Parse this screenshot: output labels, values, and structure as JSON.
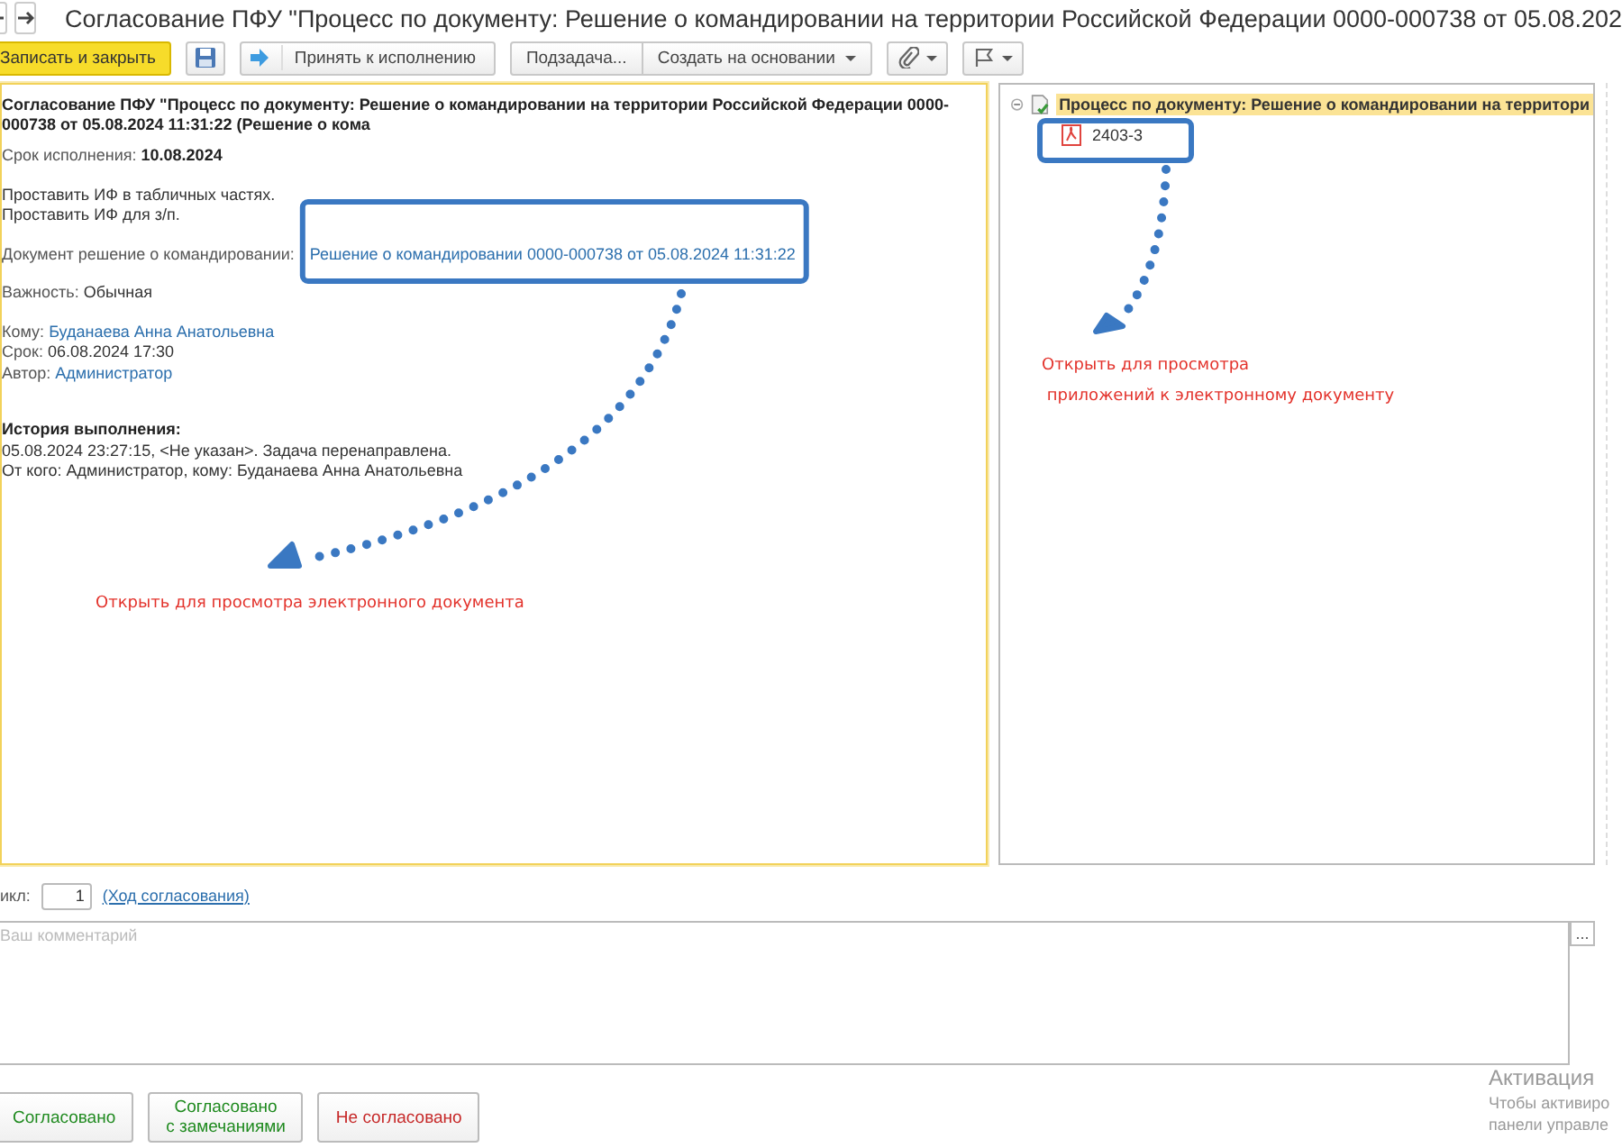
{
  "window": {
    "title": "Согласование ПФУ \"Процесс по документу: Решение о командировании на территории Российской Федерации 0000-000738 от 05.08.202"
  },
  "toolbar": [
    {
      "kind": "primary",
      "label": "Записать и закрыть"
    },
    {
      "kind": "save"
    },
    {
      "kind": "accept",
      "label": "Принять к исполнению"
    },
    {
      "kind": "group-start",
      "label": "Подзадача..."
    },
    {
      "kind": "group-dropdown",
      "label": "Создать на основании"
    },
    {
      "kind": "attach-menu"
    },
    {
      "kind": "flag-menu"
    }
  ],
  "task": {
    "title": "Согласование ПФУ \"Процесс по документу: Решение о командировании на территории Российской Федерации 0000-000738 от 05.08.2024 11:31:22 (Решение о кома",
    "due_label": "Срок исполнения:",
    "due_value": "10.08.2024",
    "description": [
      "Проставить ИФ в табличных частях.",
      "Проставить ИФ для з/п."
    ],
    "document_label": "Документ решение о командировании:",
    "document_link": "Решение о командировании 0000-000738 от 05.08.2024 11:31:22",
    "importance_label": "Важность:",
    "importance_value": "Обычная",
    "to_label": "Кому:",
    "to_value": "Буданаева Анна Анатольевна",
    "term_label": "Срок:",
    "term_value": "06.08.2024 17:30",
    "author_label": "Автор:",
    "author_value": "Администратор",
    "history_title": "История выполнения:",
    "history": [
      "05.08.2024 23:27:15, <Не указан>. Задача перенаправлена.",
      "От кого: Администратор, кому: Буданаева Анна Анатольевна"
    ]
  },
  "tree": [
    {
      "label": "Процесс по документу: Решение о командировании на территори",
      "expanded": true,
      "selected": true,
      "children": [
        {
          "label": "2403-3",
          "selected": false
        }
      ]
    }
  ],
  "cycle": {
    "label": "икл:",
    "value": "1",
    "link": "(Ход согласования)"
  },
  "comment": {
    "placeholder": "Ваш комментарий",
    "button": "..."
  },
  "actions": [
    {
      "kind": "approve",
      "label": "Согласовано"
    },
    {
      "kind": "approve",
      "label": "Согласовано\nс замечаниями"
    },
    {
      "kind": "reject",
      "label": "Не согласовано"
    }
  ],
  "annotations": [
    {
      "lines": [
        "Открыть для просмотра электронного документа"
      ]
    },
    {
      "lines": [
        "Открыть для просмотра",
        " приложений к электронному документу"
      ]
    }
  ],
  "activation_notice": {
    "title": "Активация",
    "lines": [
      "Чтобы активиро",
      "панели управле"
    ]
  }
}
